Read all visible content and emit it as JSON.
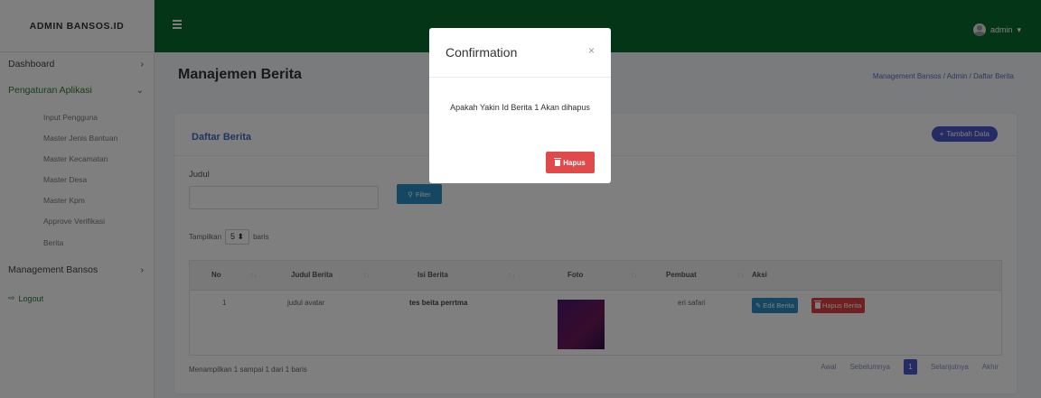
{
  "sidebar": {
    "brand": "ADMIN BANSOS.ID",
    "items": [
      {
        "label": "Dashboard",
        "chevron": "›"
      },
      {
        "label": "Pengaturan Aplikasi",
        "chevron": "⌄"
      },
      {
        "label": "Management Bansos",
        "chevron": "›"
      }
    ],
    "sub_items": [
      "Input Pengguna",
      "Master Jenis Bantuan",
      "Master Kecamatan",
      "Master Desa",
      "Master Kpm",
      "Approve Verifikasi",
      "Berita"
    ],
    "logout": "Logout"
  },
  "topbar": {
    "user": "admin"
  },
  "header": {
    "title": "Manajemen Berita",
    "breadcrumb": "Management Bansos / Admin / Daftar Berita"
  },
  "card": {
    "title": "Daftar Berita",
    "add_button": "Tambah Data",
    "filter_label": "Judul",
    "filter_value": "",
    "filter_button": "Filter",
    "show_prefix": "Tampilkan",
    "show_value": "5",
    "show_suffix": "baris"
  },
  "table": {
    "headers": [
      "No",
      "Judul Berita",
      "Isi Berita",
      "Foto",
      "Pembuat",
      "Aksi"
    ],
    "rows": [
      {
        "no": "1",
        "judul": "judul avatar",
        "isi": "tes beita perrtma",
        "pembuat": "eri safari",
        "edit": "Edit Berita",
        "hapus": "Hapus Berita"
      }
    ]
  },
  "footer": {
    "info": "Menampilkan 1 sampai 1 dari 1 baris",
    "pager": {
      "first": "Awal",
      "prev": "Sebelumnya",
      "current": "1",
      "next": "Selanjutnya",
      "last": "Akhir"
    }
  },
  "modal": {
    "title": "Confirmation",
    "close": "×",
    "message": "Apakah Yakin Id Berita 1 Akan dihapus",
    "confirm_button": "Hapus"
  },
  "colors": {
    "topbar": "#0a6b2e",
    "primary": "#4a56c9",
    "info": "#2a8fc7",
    "danger": "#e04040"
  }
}
